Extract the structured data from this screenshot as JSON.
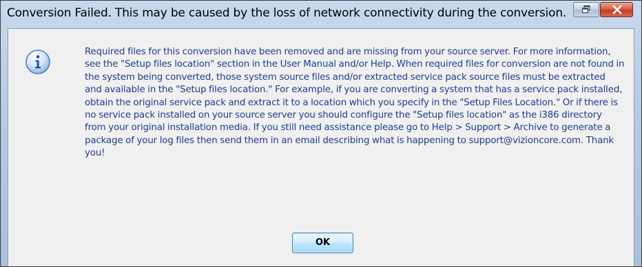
{
  "window": {
    "title": "Conversion Failed.  This may be caused by the loss of network connectivity during the conversion.",
    "restore_icon": "restore-window-icon",
    "close_icon": "close-icon",
    "close_color": "#c43a22"
  },
  "dialog": {
    "icon": "information-icon",
    "message": "Required files for this conversion have been removed and are missing from your source server. For more information, see the \"Setup files location\" section in the User Manual and/or Help. When required files for conversion are not found in the system being converted, those system source files and/or extracted service pack source files must be extracted and available in the \"Setup files location.\" For example, if you are converting a system that has a service pack installed, obtain the original service pack and extract it to a location which you specify in the \"Setup Files Location.\" Or if there is no service pack installed on your source server you should configure the \"Setup files location\" as the i386 directory from your original installation media. If you still need assistance please go to Help > Support > Archive to generate a package of your log files then send them in an email describing what is happening to support@vizioncore.com. Thank you!",
    "message_color": "#1f3c8f",
    "ok_label": "OK"
  }
}
